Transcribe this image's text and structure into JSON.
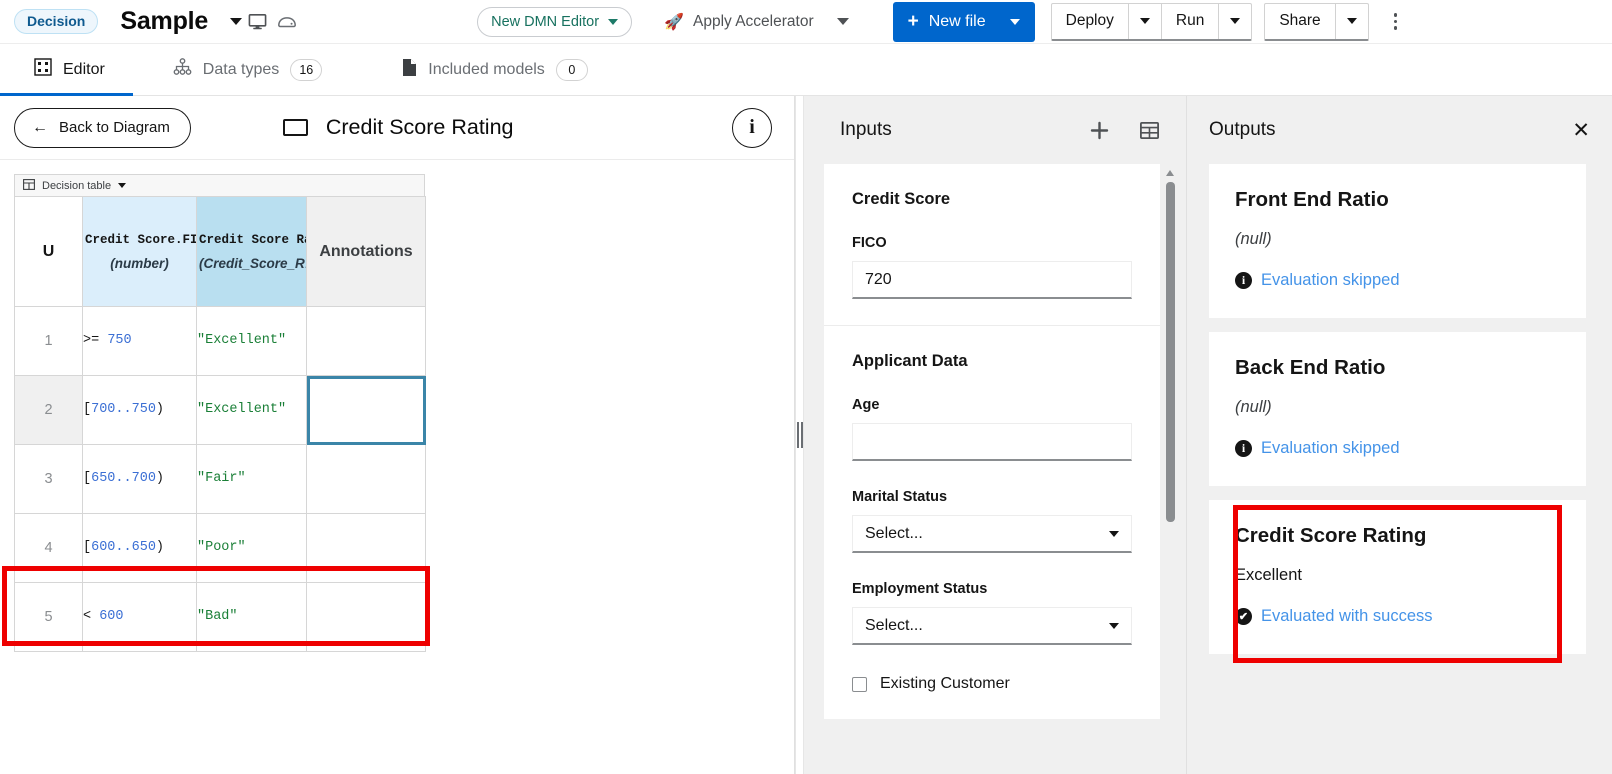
{
  "topbar": {
    "badge": "Decision",
    "file_name": "Sample",
    "title_caret_icon": "chevron-down-icon",
    "display_icon": "monitor-icon",
    "save_icon": "save-disk-icon",
    "editor_switch_label": "New DMN Editor",
    "accelerator_label": "Apply Accelerator",
    "accelerator_icon": "rocket-icon",
    "new_file_label": "New file",
    "deploy_label": "Deploy",
    "run_label": "Run",
    "share_label": "Share",
    "kebab_icon": "vertical-dots-icon",
    "primary_color": "#0066cc"
  },
  "tabs": [
    {
      "label": "Editor",
      "icon": "editor-grid-icon",
      "count": null,
      "active": true
    },
    {
      "label": "Data types",
      "icon": "hierarchy-icon",
      "count": "16",
      "active": false
    },
    {
      "label": "Included models",
      "icon": "document-icon",
      "count": "0",
      "active": false
    }
  ],
  "editor": {
    "back_label": "Back to Diagram",
    "back_icon": "arrow-left-icon",
    "node_icon": "decision-node-icon",
    "title": "Credit Score Rating",
    "info_icon": "info-icon",
    "table_kind_label": "Decision table",
    "table_kind_icon": "table-icon"
  },
  "decision_table": {
    "hit_policy": "U",
    "columns": [
      {
        "name": "Credit Score.FI…",
        "type": "(number)",
        "kind": "input"
      },
      {
        "name": "Credit Score Ra…",
        "type": "(Credit_Score_R…",
        "kind": "output"
      }
    ],
    "annotations_header": "Annotations",
    "rows": [
      {
        "index": "1",
        "input_prefix": ">= ",
        "input_number": "750",
        "input_suffix": "",
        "output": "\"Excellent\"",
        "annotation": "",
        "selected": false,
        "focused": false
      },
      {
        "index": "2",
        "input_prefix": "[",
        "input_number": "700..750",
        "input_suffix": ")",
        "output": "\"Excellent\"",
        "annotation": "",
        "selected": true,
        "focused": true
      },
      {
        "index": "3",
        "input_prefix": "[",
        "input_number": "650..700",
        "input_suffix": ")",
        "output": "\"Fair\"",
        "annotation": "",
        "selected": false,
        "focused": false
      },
      {
        "index": "4",
        "input_prefix": "[",
        "input_number": "600..650",
        "input_suffix": ")",
        "output": "\"Poor\"",
        "annotation": "",
        "selected": false,
        "focused": false
      },
      {
        "index": "5",
        "input_prefix": "< ",
        "input_number": "600",
        "input_suffix": "",
        "output": "\"Bad\"",
        "annotation": "",
        "selected": false,
        "focused": false
      }
    ]
  },
  "inputs": {
    "title": "Inputs",
    "add_icon": "plus-icon",
    "table_view_icon": "table-view-icon",
    "groups": [
      {
        "title": "Credit Score",
        "fields": [
          {
            "label": "FICO",
            "type": "text",
            "value": "720",
            "placeholder": ""
          }
        ]
      },
      {
        "title": "Applicant Data",
        "fields": [
          {
            "label": "Age",
            "type": "text",
            "value": "",
            "placeholder": ""
          },
          {
            "label": "Marital Status",
            "type": "select",
            "value": "Select...",
            "placeholder": "Select..."
          },
          {
            "label": "Employment Status",
            "type": "select",
            "value": "Select...",
            "placeholder": "Select..."
          }
        ],
        "checkbox": {
          "label": "Existing Customer",
          "checked": false
        }
      }
    ]
  },
  "outputs": {
    "title": "Outputs",
    "close_icon": "close-icon",
    "cards": [
      {
        "title": "Front End Ratio",
        "value": "(null)",
        "is_null": true,
        "status": "Evaluation skipped",
        "status_icon": "info-icon",
        "highlighted": false
      },
      {
        "title": "Back End Ratio",
        "value": "(null)",
        "is_null": true,
        "status": "Evaluation skipped",
        "status_icon": "info-icon",
        "highlighted": false
      },
      {
        "title": "Credit Score Rating",
        "value": "Excellent",
        "is_null": false,
        "status": "Evaluated with success",
        "status_icon": "check-circle-icon",
        "highlighted": true
      }
    ]
  },
  "highlight_color": "#ee0000",
  "focus_color": "#3b85a8"
}
